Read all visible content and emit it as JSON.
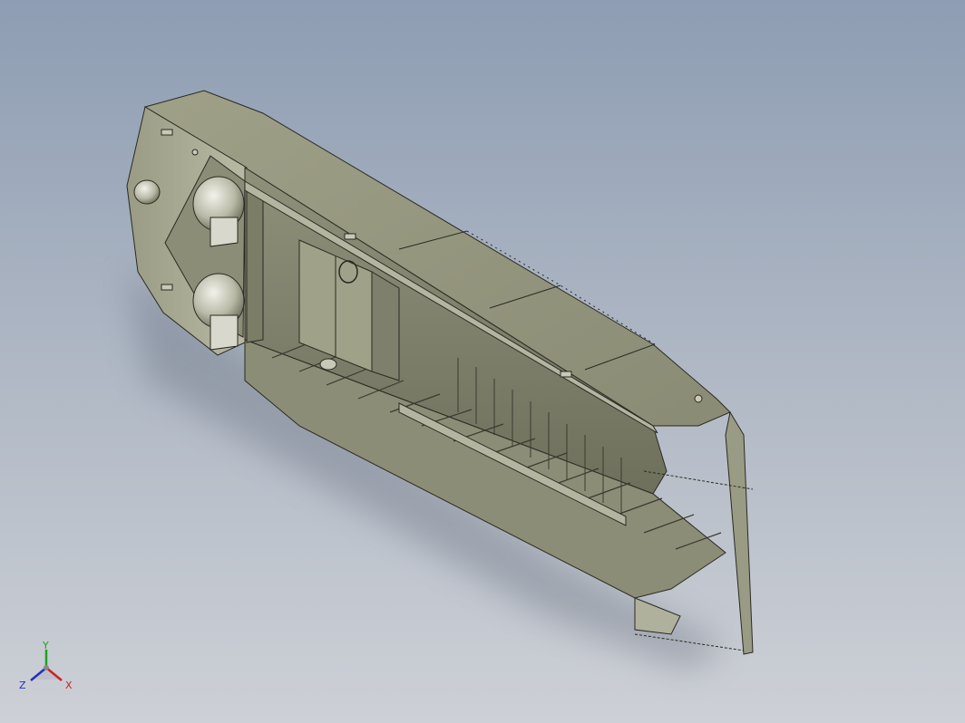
{
  "triad": {
    "x_label": "X",
    "y_label": "Y",
    "z_label": "Z"
  },
  "colors": {
    "background_top": "#8e9db3",
    "background_bottom": "#cdd0d6",
    "hull": "#a2a38c",
    "hull_dark": "#74765f",
    "hull_light": "#c4c5b1",
    "edge": "#2a2a22",
    "axis_x": "#d02020",
    "axis_y": "#20a020",
    "axis_z": "#2030c0"
  },
  "icons": {
    "triad": "coordinate-triad-icon"
  }
}
